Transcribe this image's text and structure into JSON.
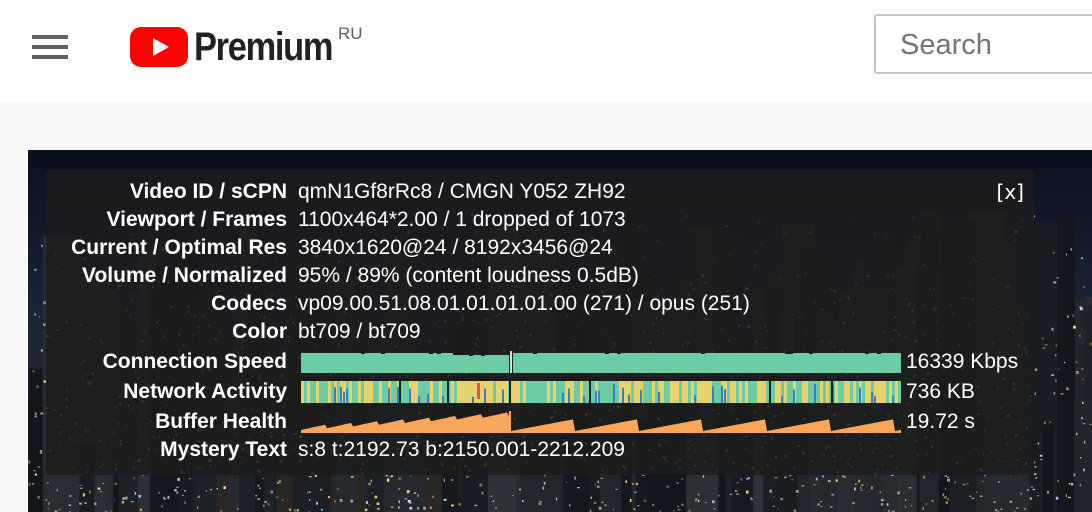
{
  "header": {
    "brand": "Premium",
    "region": "RU",
    "search_placeholder": "Search"
  },
  "stats": {
    "close_label": "[x]",
    "rows": {
      "video_id": {
        "label": "Video ID / sCPN",
        "value": "qmN1Gf8rRc8 / CMGN Y052 ZH92"
      },
      "viewport": {
        "label": "Viewport / Frames",
        "value": "1100x464*2.00 / 1 dropped of 1073"
      },
      "resolution": {
        "label": "Current / Optimal Res",
        "value": "3840x1620@24 / 8192x3456@24"
      },
      "volume": {
        "label": "Volume / Normalized",
        "value": "95% / 89% (content loudness 0.5dB)"
      },
      "codecs": {
        "label": "Codecs",
        "value": "vp09.00.51.08.01.01.01.01.00 (271) / opus (251)"
      },
      "color": {
        "label": "Color",
        "value": "bt709 / bt709"
      },
      "connection_speed": {
        "label": "Connection Speed",
        "value": "16339 Kbps"
      },
      "network_activity": {
        "label": "Network Activity",
        "value": "736 KB"
      },
      "buffer_health": {
        "label": "Buffer Health",
        "value": "19.72 s"
      },
      "mystery_text": {
        "label": "Mystery Text",
        "value": "s:8 t:2192.73 b:2150.001-2212.209"
      }
    }
  },
  "colors": {
    "brand_red": "#ff0000",
    "connection_speed": "#6dcca3",
    "network_activity": "#6dcca3",
    "network_activity_alt": "#e6d36d",
    "network_activity_spike": "#3a7fbf",
    "buffer_health": "#f7a65a"
  },
  "icons": {
    "menu": "hamburger-menu-icon",
    "logo": "youtube-play-logo-icon"
  }
}
